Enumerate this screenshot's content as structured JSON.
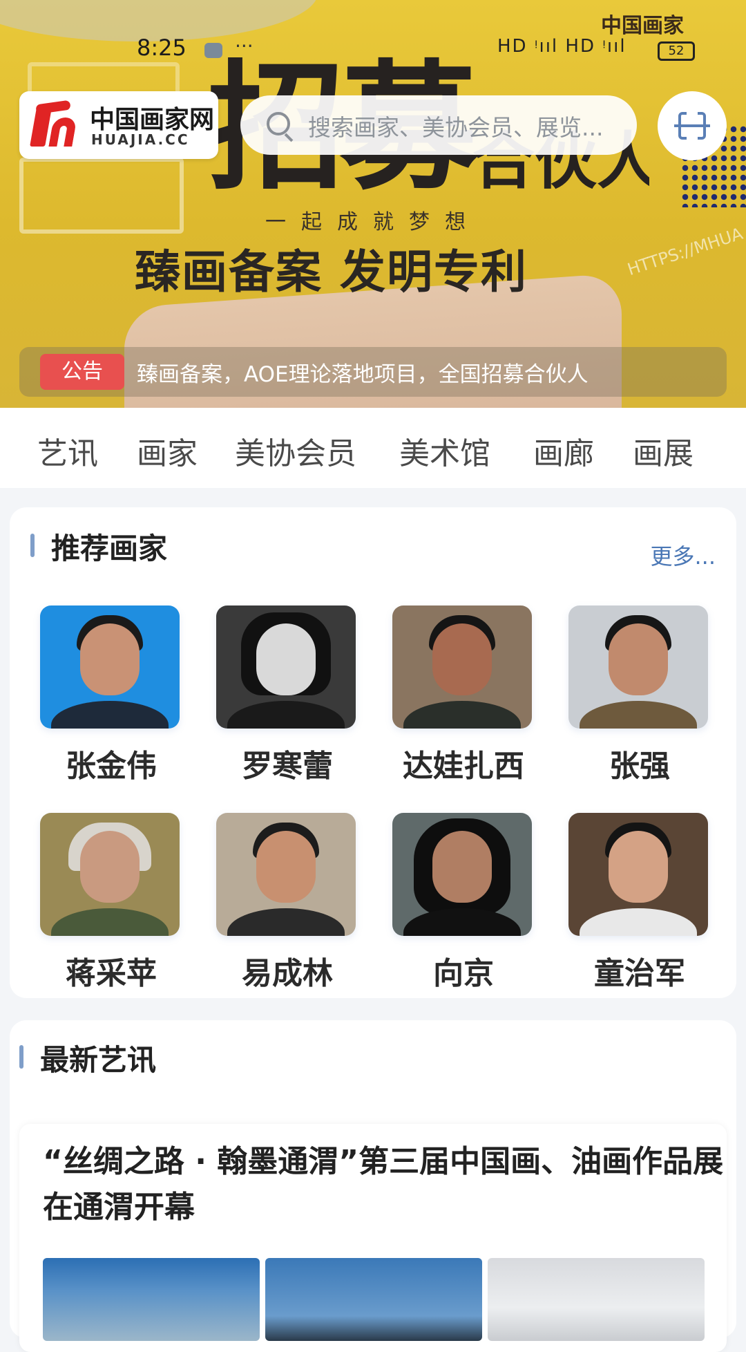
{
  "status_bar": {
    "time": "8:25",
    "more": "···",
    "signal_text": "HD ᵎııl HD ᵎııl",
    "battery": "52"
  },
  "hero": {
    "big_text": "招募",
    "big_text_sub": "合伙人",
    "slogan": "一起成就梦想",
    "tagline": "臻画备案 发明专利",
    "corner_logo": "中国画家",
    "side_text": "HTTPS://MHUA"
  },
  "header": {
    "logo_cn": "中国画家网",
    "logo_en": "HUAJIA.CC",
    "search_placeholder": "搜索画家、美协会员、展览...",
    "scan_icon": "scan-icon"
  },
  "notice": {
    "tag": "公告",
    "text": "臻画备案，AOE理论落地项目，全国招募合伙人"
  },
  "nav": {
    "items": [
      "艺讯",
      "画家",
      "美协会员",
      "美术馆",
      "画廊",
      "画展"
    ]
  },
  "recommended": {
    "title": "推荐画家",
    "more": "更多...",
    "artists": [
      {
        "name": "张金伟"
      },
      {
        "name": "罗寒蕾"
      },
      {
        "name": "达娃扎西"
      },
      {
        "name": "张强"
      },
      {
        "name": "蒋采苹"
      },
      {
        "name": "易成林"
      },
      {
        "name": "向京"
      },
      {
        "name": "童治军"
      }
    ]
  },
  "news": {
    "title": "最新艺讯",
    "articles": [
      {
        "title": "“丝绸之路 · 翰墨通渭”第三届中国画、油画作品展在通渭开幕"
      }
    ]
  },
  "colors": {
    "accent": "#4a77b5",
    "notice_tag": "#e8504f",
    "hero_yellow": "#e3c236",
    "logo_red": "#e02424"
  }
}
